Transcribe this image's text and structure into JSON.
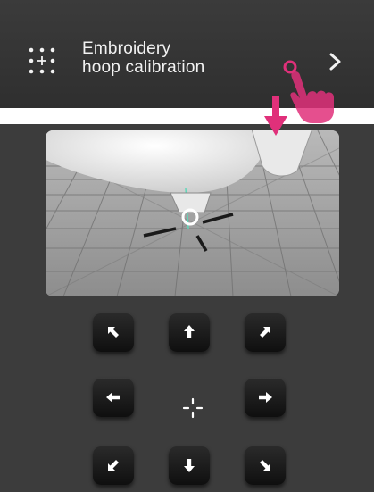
{
  "menu": {
    "icon": "grid-plus-icon",
    "label_line1": "Embroidery",
    "label_line2": "hoop calibration",
    "chevron": "chevron-right-icon",
    "gesture_icon": "tap-hand-icon"
  },
  "camera": {
    "description_icon": "camera-view",
    "indicator": "down-arrow-icon"
  },
  "controls": {
    "buttons": [
      "up-left",
      "up",
      "up-right",
      "left",
      "center",
      "right",
      "down-left",
      "down",
      "down-right"
    ]
  },
  "colors": {
    "accent": "#e0307a",
    "bar_bg": "#333333",
    "panel_bg": "#3c3c3c",
    "button_bg": "#1a1a1a"
  }
}
